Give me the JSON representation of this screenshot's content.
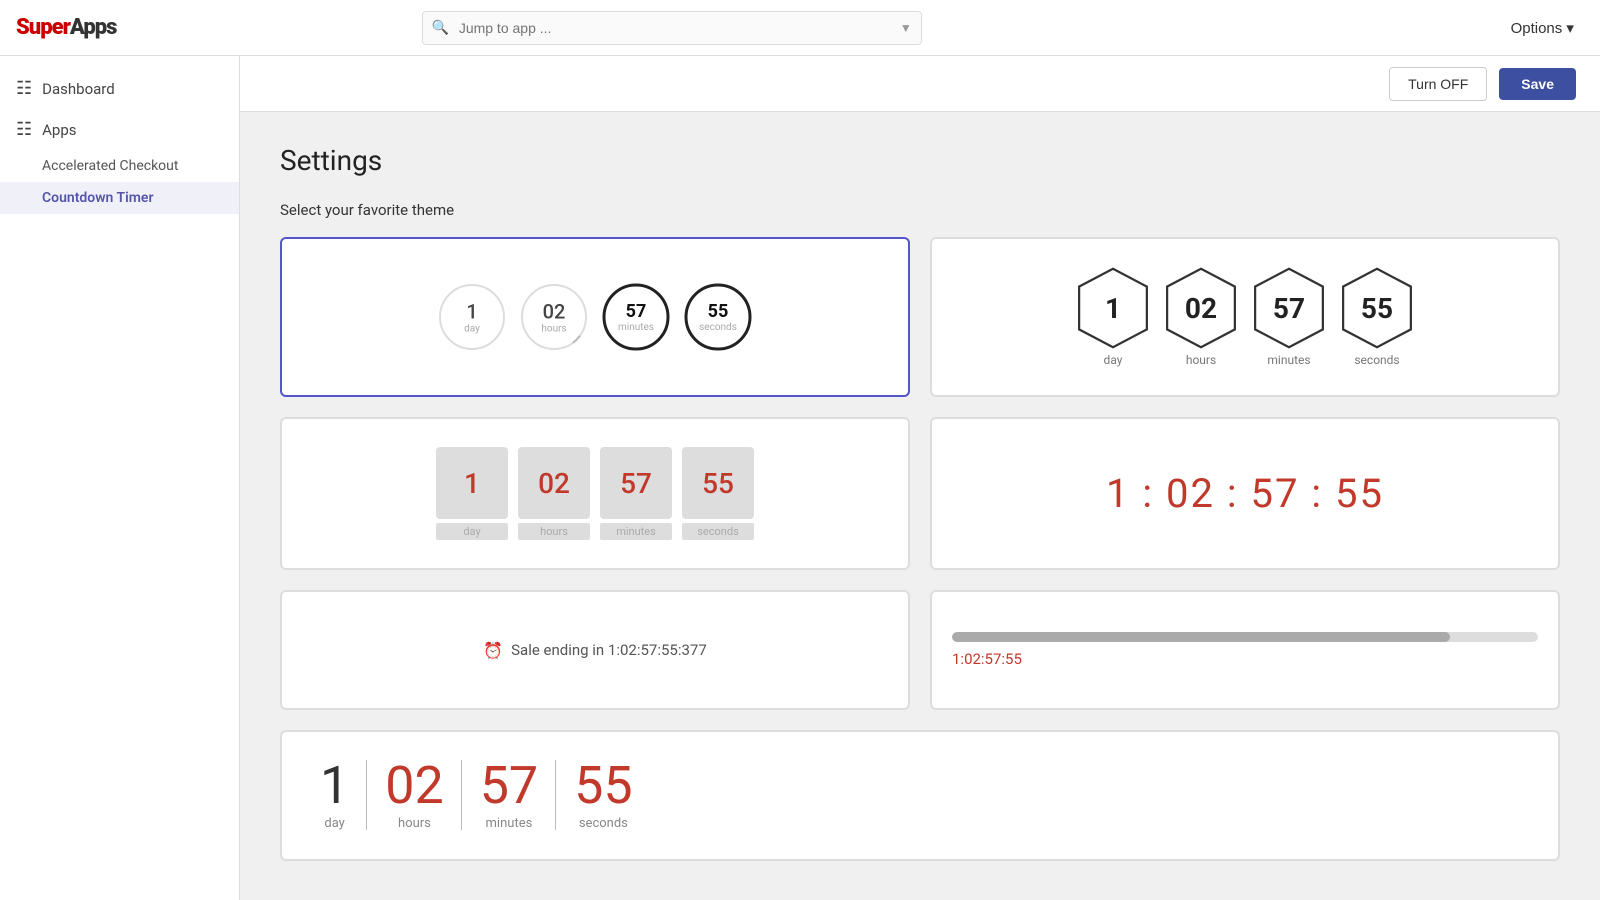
{
  "app": {
    "logo": "SuperApps",
    "search_placeholder": "Jump to app ...",
    "options_label": "Options ▾"
  },
  "topbar": {
    "turn_off_label": "Turn OFF",
    "save_label": "Save"
  },
  "sidebar": {
    "dashboard_label": "Dashboard",
    "apps_label": "Apps",
    "accelerated_checkout_label": "Accelerated Checkout",
    "countdown_timer_label": "Countdown Timer"
  },
  "settings": {
    "page_title": "Settings",
    "section_label": "Select your favorite theme"
  },
  "timer": {
    "days": "1",
    "hours": "02",
    "minutes": "57",
    "seconds": "55",
    "day_label": "day",
    "hours_label": "hours",
    "minutes_label": "minutes",
    "seconds_label": "seconds",
    "sale_text": "Sale ending in 1:02:57:55:377",
    "progress_text": "1:02:57:55",
    "colon_text": "1 : 02 : 57 : 55"
  }
}
